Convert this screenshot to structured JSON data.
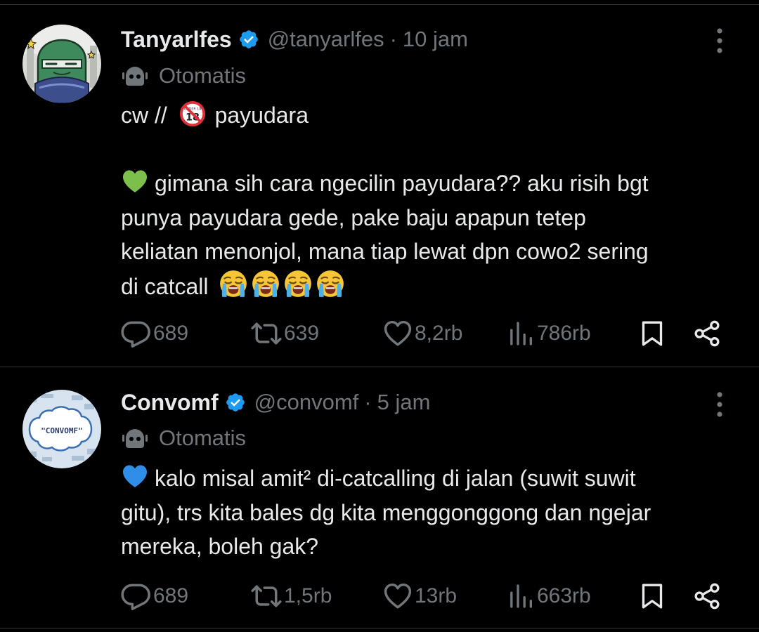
{
  "tweets": [
    {
      "name": "Tanyarlfes",
      "handle": "@tanyarlfes",
      "separator": "·",
      "time": "10 jam",
      "automated_label": "Otomatis",
      "lines": [
        "cw //",
        "payudara",
        "gimana sih cara ngecilin payudara?? aku risih bgt",
        "punya payudara gede, pake baju apapun tetep",
        "keliatan menonjol, mana tiap lewat dpn cowo2 sering",
        "di catcall"
      ],
      "emoji_18_label": "UNDER 18",
      "stats": {
        "replies": "689",
        "reposts": "639",
        "likes": "8,2rb",
        "views": "786rb"
      }
    },
    {
      "name": "Convomf",
      "handle": "@convomf",
      "separator": "·",
      "time": "5 jam",
      "automated_label": "Otomatis",
      "avatar_text": "\"CONVOMF\"",
      "lines": [
        "kalo misal amit² di-catcalling di jalan (suwit suwit",
        "gitu), trs kita bales dg kita menggonggong dan ngejar",
        "mereka, boleh gak?"
      ],
      "stats": {
        "replies": "689",
        "reposts": "1,5rb",
        "likes": "13rb",
        "views": "663rb"
      }
    }
  ],
  "colors": {
    "background": "#000000",
    "text": "#e7e9ea",
    "muted": "#71767b",
    "verified": "#1d9bf0",
    "divider": "#2f3336"
  },
  "icons": [
    "verified-badge-icon",
    "more-dots-icon",
    "robot-icon",
    "reply-icon",
    "repost-icon",
    "like-icon",
    "views-icon",
    "bookmark-icon",
    "share-icon",
    "green-heart-emoji",
    "blue-heart-emoji",
    "no-under-18-emoji",
    "loudly-crying-face-emoji"
  ]
}
